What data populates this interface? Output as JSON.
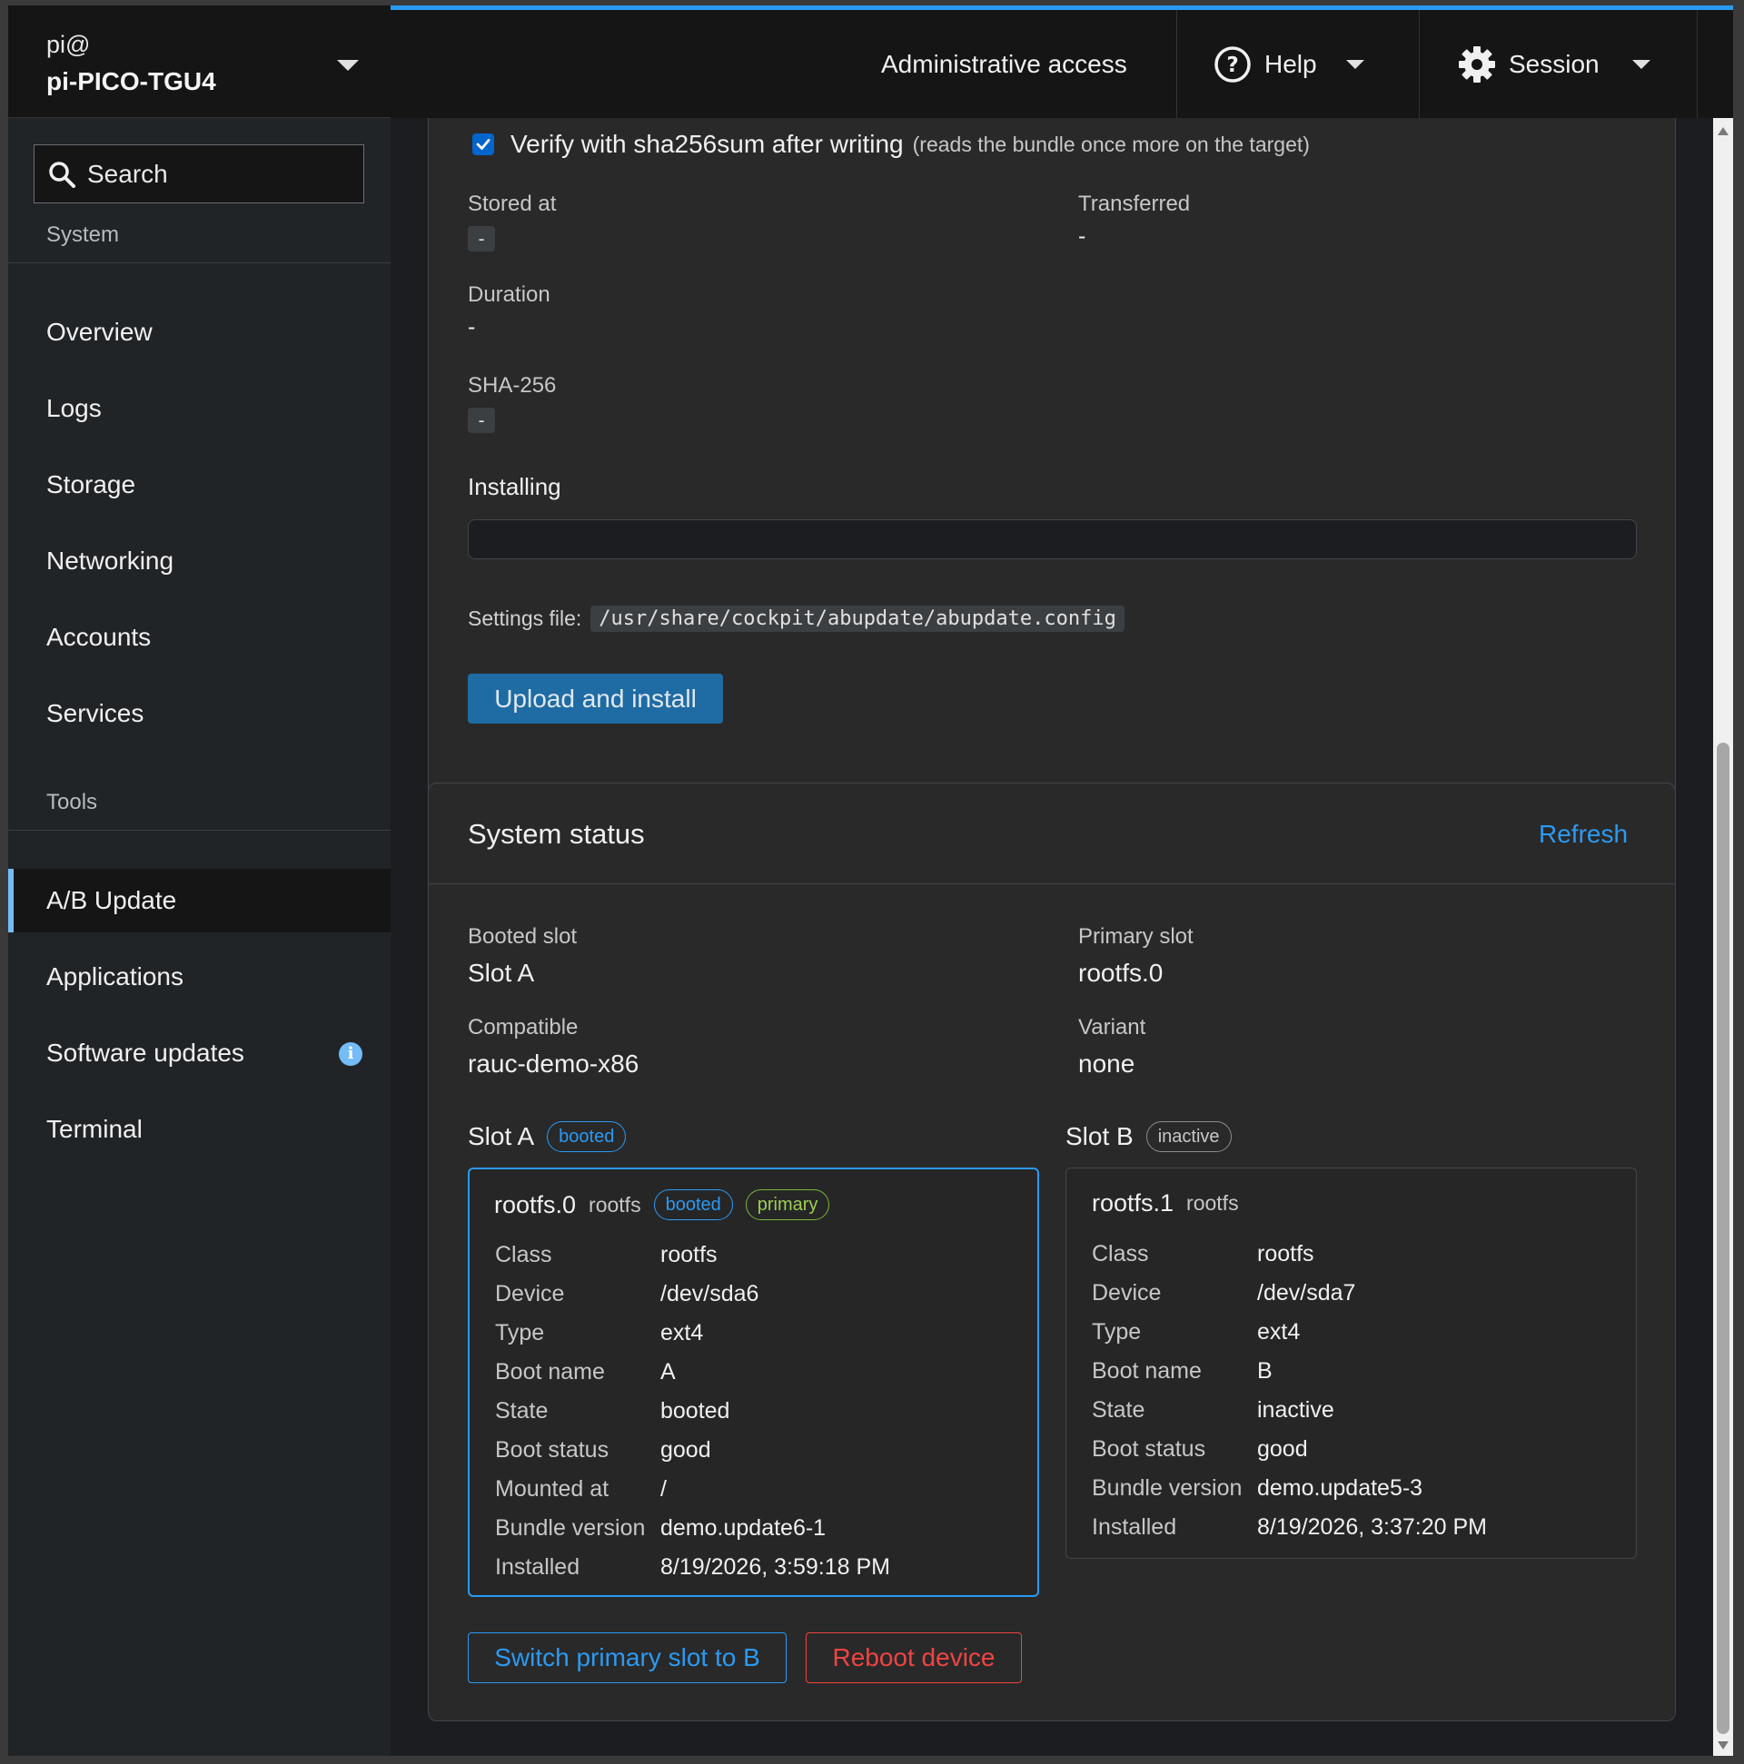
{
  "host": {
    "user": "pi@",
    "name": "pi-PICO-TGU4"
  },
  "search": {
    "placeholder": "Search"
  },
  "sidebar": {
    "system_heading": "System",
    "system_items": [
      "Overview",
      "Logs",
      "Storage",
      "Networking",
      "Accounts",
      "Services"
    ],
    "tools_heading": "Tools",
    "tools_items": [
      "A/B Update",
      "Applications",
      "Software updates",
      "Terminal"
    ],
    "active_item": "A/B Update",
    "info_badge": "i"
  },
  "topbar": {
    "admin": "Administrative access",
    "help": "Help",
    "session": "Session"
  },
  "upload": {
    "verify_label": "Verify with sha256sum after writing",
    "verify_hint": "(reads the bundle once more on the target)",
    "verify_checked": true,
    "stored_at_label": "Stored at",
    "stored_at_value": "-",
    "transferred_label": "Transferred",
    "transferred_value": "-",
    "duration_label": "Duration",
    "duration_value": "-",
    "sha_label": "SHA-256",
    "sha_value": "-",
    "installing_label": "Installing",
    "installing_progress": 0,
    "settings_label": "Settings file:",
    "settings_path": "/usr/share/cockpit/abupdate/abupdate.config",
    "upload_button": "Upload and install"
  },
  "status": {
    "title": "System status",
    "refresh": "Refresh",
    "booted_slot_label": "Booted slot",
    "booted_slot_value": "Slot A",
    "primary_slot_label": "Primary slot",
    "primary_slot_value": "rootfs.0",
    "compatible_label": "Compatible",
    "compatible_value": "rauc-demo-x86",
    "variant_label": "Variant",
    "variant_value": "none",
    "slot_a": {
      "heading": "Slot A",
      "badge": "booted",
      "name": "rootfs.0",
      "class_tag": "rootfs",
      "badges": [
        "booted",
        "primary"
      ],
      "rows": [
        {
          "k": "Class",
          "v": "rootfs"
        },
        {
          "k": "Device",
          "v": "/dev/sda6"
        },
        {
          "k": "Type",
          "v": "ext4"
        },
        {
          "k": "Boot name",
          "v": "A"
        },
        {
          "k": "State",
          "v": "booted"
        },
        {
          "k": "Boot status",
          "v": "good"
        },
        {
          "k": "Mounted at",
          "v": "/"
        },
        {
          "k": "Bundle version",
          "v": "demo.update6-1"
        },
        {
          "k": "Installed",
          "v": "8/19/2026, 3:59:18 PM"
        }
      ]
    },
    "slot_b": {
      "heading": "Slot B",
      "badge": "inactive",
      "name": "rootfs.1",
      "class_tag": "rootfs",
      "rows": [
        {
          "k": "Class",
          "v": "rootfs"
        },
        {
          "k": "Device",
          "v": "/dev/sda7"
        },
        {
          "k": "Type",
          "v": "ext4"
        },
        {
          "k": "Boot name",
          "v": "B"
        },
        {
          "k": "State",
          "v": "inactive"
        },
        {
          "k": "Boot status",
          "v": "good"
        },
        {
          "k": "Bundle version",
          "v": "demo.update5-3"
        },
        {
          "k": "Installed",
          "v": "8/19/2026, 3:37:20 PM"
        }
      ]
    },
    "switch_button": "Switch primary slot to B",
    "reboot_button": "Reboot device"
  },
  "colors": {
    "accent": "#2b9af3",
    "danger": "#ef4444",
    "success": "#9dce54",
    "background": "#1b1d21",
    "card": "#292929"
  }
}
